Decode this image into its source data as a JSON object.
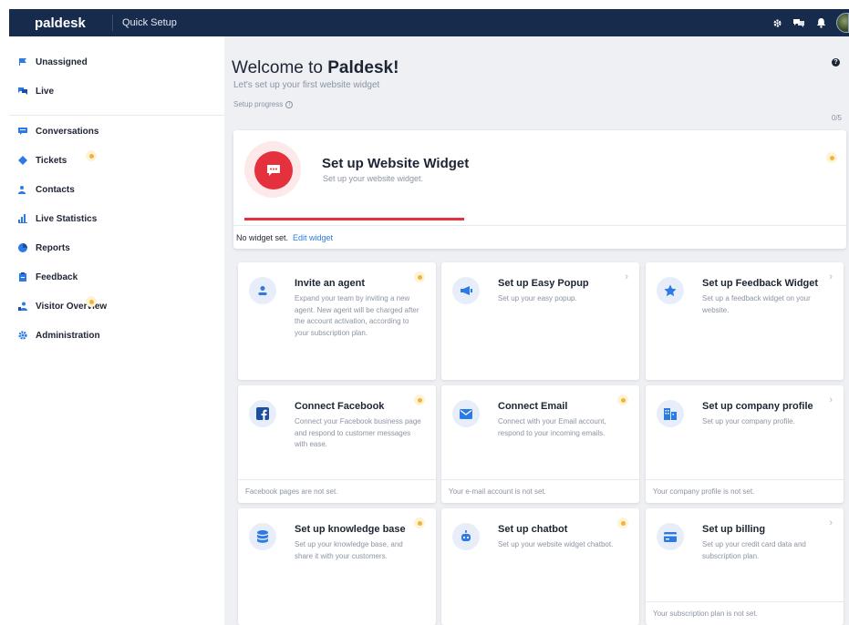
{
  "header": {
    "brand": "paldesk",
    "tab": "Quick Setup",
    "icons": [
      "gear-icon",
      "chat-icon",
      "bell-icon",
      "avatar"
    ]
  },
  "sidebar": {
    "items": [
      {
        "label": "Unassigned",
        "icon": "flag-icon"
      },
      {
        "label": "Live",
        "icon": "chat-bubbles-icon"
      },
      {
        "label": "Conversations",
        "icon": "message-icon"
      },
      {
        "label": "Tickets",
        "icon": "ticket-icon"
      },
      {
        "label": "Contacts",
        "icon": "contacts-icon"
      },
      {
        "label": "Live Statistics",
        "icon": "bar-chart-icon"
      },
      {
        "label": "Reports",
        "icon": "pie-chart-icon"
      },
      {
        "label": "Feedback",
        "icon": "clipboard-icon"
      },
      {
        "label": "Visitor Overview",
        "icon": "visitors-icon"
      },
      {
        "label": "Administration",
        "icon": "gear-icon"
      }
    ]
  },
  "main": {
    "welcome_prefix": "Welcome to ",
    "welcome_brand": "Paldesk!",
    "subtitle": "Let's set up your first website widget",
    "progress_label": "Setup progress",
    "progress_count": "0/5",
    "progress_value": 0
  },
  "hero": {
    "title": "Set up Website Widget",
    "subtitle": "Set up your website widget.",
    "footer_status": "No widget set.",
    "footer_link": "Edit widget",
    "accent": "#e5303d"
  },
  "cards": [
    {
      "title": "Invite an agent",
      "desc": "Expand your team by inviting a new agent. New agent will be charged after the account activation, according to your subscription plan.",
      "icon": "user-icon",
      "footer": ""
    },
    {
      "title": "Set up Easy Popup",
      "desc": "Set up your easy popup.",
      "icon": "megaphone-icon",
      "footer": ""
    },
    {
      "title": "Set up Feedback Widget",
      "desc": "Set up a feedback widget on your website.",
      "icon": "star-icon",
      "footer": ""
    },
    {
      "title": "Connect Facebook",
      "desc": "Connect your Facebook business page and respond to customer messages with ease.",
      "icon": "facebook-icon",
      "footer": "Facebook pages are not set."
    },
    {
      "title": "Connect Email",
      "desc": "Connect with your Email account, respond to your incoming emails.",
      "icon": "envelope-icon",
      "footer": "Your e-mail account is not set."
    },
    {
      "title": "Set up company profile",
      "desc": "Set up your company profile.",
      "icon": "building-icon",
      "footer": "Your company profile is not set."
    },
    {
      "title": "Set up knowledge base",
      "desc": "Set up your knowledge base, and share it with your customers.",
      "icon": "database-icon",
      "footer": ""
    },
    {
      "title": "Set up chatbot",
      "desc": "Set up your website widget chatbot.",
      "icon": "robot-icon",
      "footer": ""
    },
    {
      "title": "Set up billing",
      "desc": "Set up your credit card data and subscription plan.",
      "icon": "credit-card-icon",
      "footer": "Your subscription plan is not set."
    }
  ],
  "colors": {
    "topbar": "#172b4d",
    "accent_red": "#e5303d",
    "icon_blue": "#2c7be5",
    "badge_yellow": "#f0b43c"
  }
}
